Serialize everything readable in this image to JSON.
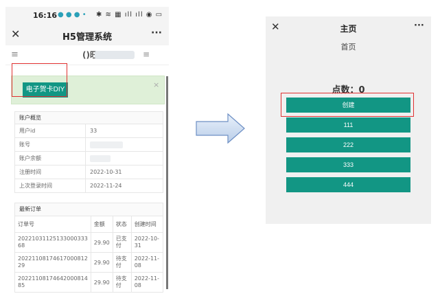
{
  "left": {
    "status_time": "16:16",
    "status_dots": "● ● ● •",
    "status_right": "✱ ≋ ▦ ıll ıll ◉ ▭",
    "window_title": "H5管理系统",
    "close_glyph": "✕",
    "more_glyph": "···",
    "menu_glyph": "≡",
    "logo_text": "()旺",
    "alert_close": "×",
    "diy_button": "电子贺卡DIY",
    "account": {
      "title": "账户概览",
      "rows": [
        {
          "label": "用户id",
          "value": "33"
        },
        {
          "label": "账号",
          "value": ""
        },
        {
          "label": "账户余额",
          "value": ""
        },
        {
          "label": "注册时间",
          "value": "2022-10-31"
        },
        {
          "label": "上次登录时间",
          "value": "2022-11-24"
        }
      ]
    },
    "orders": {
      "title": "最新订单",
      "headers": [
        "订单号",
        "金额",
        "状态",
        "创建时间"
      ],
      "rows": [
        {
          "id": "20221031125133000333 68",
          "amount": "29.90",
          "status": "已支付",
          "time": "2022-10-31"
        },
        {
          "id": "20221108174617000812 29",
          "amount": "29.90",
          "status": "待支付",
          "time": "2022-11-08"
        },
        {
          "id": "20221108174642000814 85",
          "amount": "29.90",
          "status": "待支付",
          "time": "2022-11-08"
        }
      ]
    }
  },
  "right": {
    "close_glyph": "✕",
    "title": "主页",
    "more_glyph": "···",
    "subtitle": "首页",
    "points_label": "点数：0",
    "buttons": [
      "创建",
      "111",
      "222",
      "333",
      "444"
    ]
  },
  "colors": {
    "accent": "#129684",
    "annotation": "#e03030",
    "alert_bg": "#dff0d8"
  }
}
